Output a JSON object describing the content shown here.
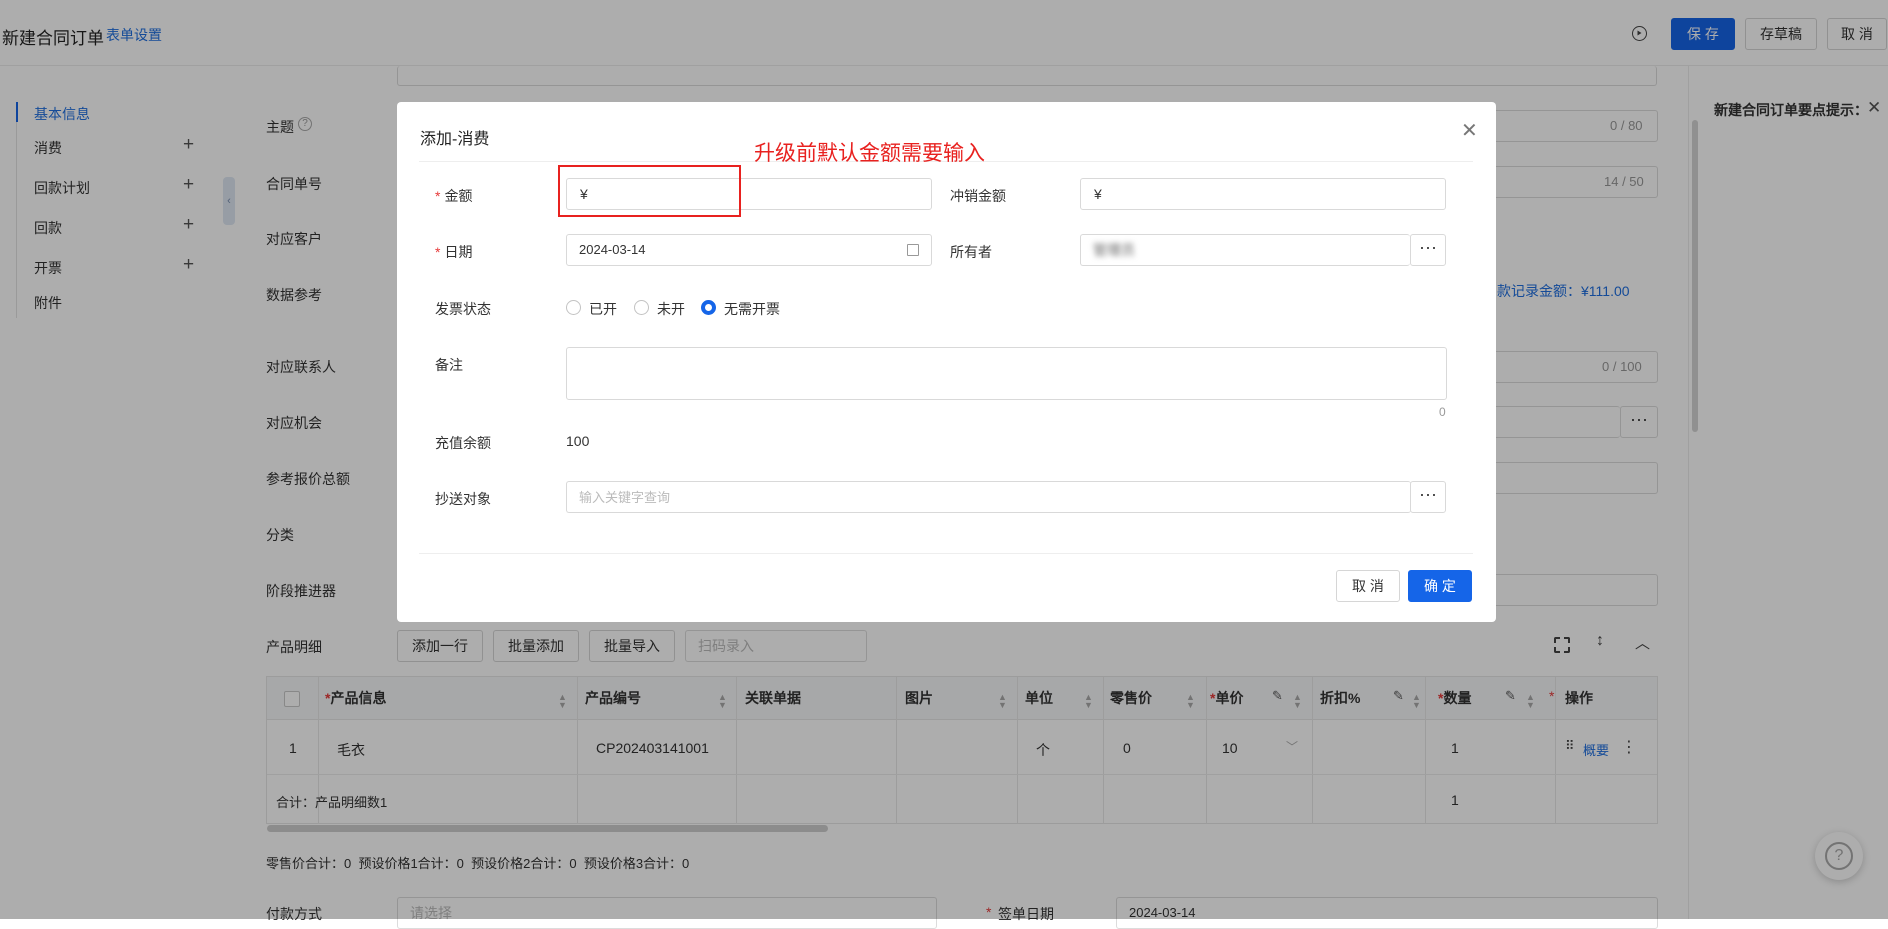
{
  "header": {
    "title": "新建合同订单",
    "form_settings": "表单设置",
    "save": "保 存",
    "draft": "存草稿",
    "cancel": "取 消"
  },
  "sidebar": {
    "items": [
      {
        "label": "基本信息",
        "plus": ""
      },
      {
        "label": "消费",
        "plus": "+"
      },
      {
        "label": "回款计划",
        "plus": "+"
      },
      {
        "label": "回款",
        "plus": "+"
      },
      {
        "label": "开票",
        "plus": "+"
      },
      {
        "label": "附件",
        "plus": ""
      }
    ]
  },
  "form": {
    "labels": {
      "subject": "主题",
      "contract_no": "合同单号",
      "customer": "对应客户",
      "data_ref": "数据参考",
      "contact": "对应联系人",
      "opportunity": "对应机会",
      "quote_total": "参考报价总额",
      "category": "分类",
      "stage": "阶段推进器",
      "products": "产品明细",
      "payment": "付款方式",
      "sign_date": "签单日期"
    },
    "subject_counter": "0 / 80",
    "contract_counter": "14 / 50",
    "contact_counter": "0 / 100",
    "ref_text": "款记录金额：¥111.00",
    "payment_placeholder": "请选择",
    "sign_date_value": "2024-03-14",
    "sign_req": "*",
    "tips_title": "新建合同订单要点提示："
  },
  "products": {
    "buttons": {
      "add_row": "添加一行",
      "batch_add": "批量添加",
      "batch_import": "批量导入",
      "scan_placeholder": "扫码录入"
    },
    "columns": {
      "info": "产品信息",
      "code": "产品编号",
      "related": "关联单据",
      "image": "图片",
      "unit": "单位",
      "retail": "零售价",
      "price": "单价",
      "discount": "折扣%",
      "qty": "数量",
      "action": "操作"
    },
    "row": {
      "index": "1",
      "name": "毛衣",
      "code": "CP202403141001",
      "unit": "个",
      "retail": "0",
      "price": "10",
      "qty": "1",
      "summary_link": "概要"
    },
    "total_row": {
      "label": "合计：产品明细数1",
      "qty": "1"
    },
    "summary": "零售价合计：0  预设价格1合计：0  预设价格2合计：0  预设价格3合计：0"
  },
  "modal": {
    "title": "添加-消费",
    "annotation": "升级前默认金额需要输入",
    "amount_label": "金额",
    "amount_prefix": "¥",
    "offset_label": "冲销金额",
    "offset_prefix": "¥",
    "date_label": "日期",
    "date_value": "2024-03-14",
    "owner_label": "所有者",
    "owner_value": "管理员",
    "invoice_label": "发票状态",
    "invoice_options": [
      "已开",
      "未开",
      "无需开票"
    ],
    "invoice_selected": "无需开票",
    "remark_label": "备注",
    "remark_count": "0",
    "balance_label": "充值余额",
    "balance_value": "100",
    "cc_label": "抄送对象",
    "cc_placeholder": "输入关键字查询",
    "cancel": "取 消",
    "confirm": "确 定"
  },
  "colors": {
    "primary": "#1565e8",
    "required": "#e63939",
    "annotation": "#e8211f"
  }
}
